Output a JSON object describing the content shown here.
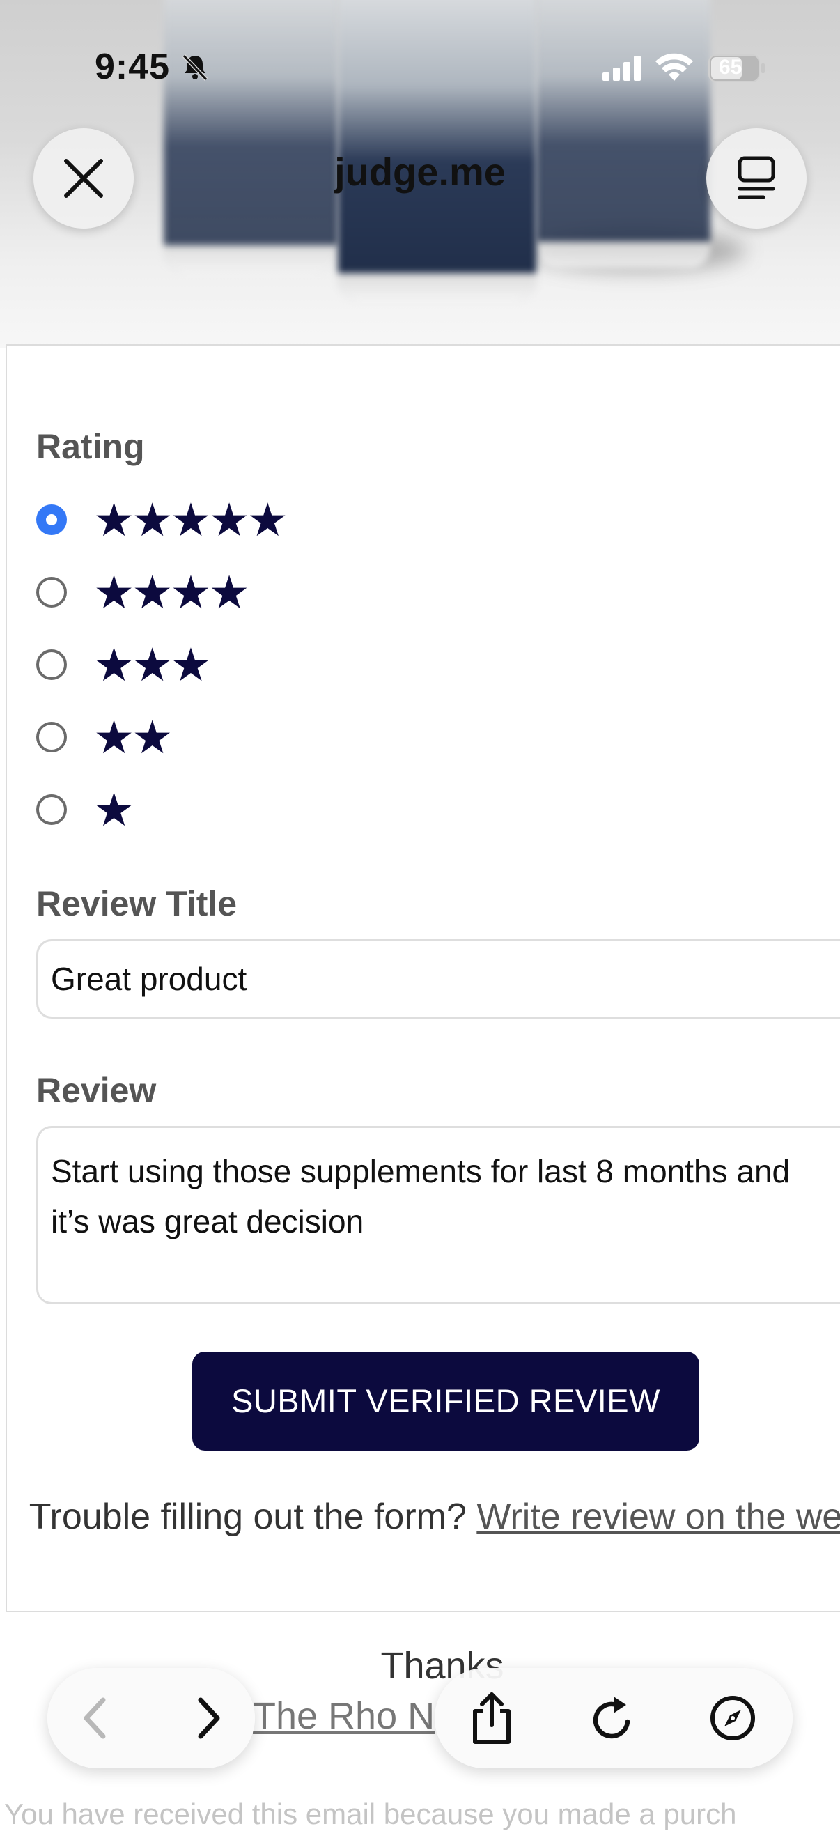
{
  "status_bar": {
    "time": "9:45",
    "battery": "65"
  },
  "header": {
    "site_title": "judge.me"
  },
  "form": {
    "rating_label": "Rating",
    "rating_options": [
      {
        "stars": "★★★★★",
        "value": 5,
        "selected": true
      },
      {
        "stars": "★★★★",
        "value": 4,
        "selected": false
      },
      {
        "stars": "★★★",
        "value": 3,
        "selected": false
      },
      {
        "stars": "★★",
        "value": 2,
        "selected": false
      },
      {
        "stars": "★",
        "value": 1,
        "selected": false
      }
    ],
    "review_title_label": "Review Title",
    "review_title_value": "Great product",
    "review_label": "Review",
    "review_value_line1": "Start using those supplements for last 8 months and",
    "review_value_line2": "it’s was great decision",
    "submit_label": "SUBMIT VERIFIED REVIEW",
    "trouble_text": "Trouble filling out the form?",
    "trouble_link": "Write review on the web"
  },
  "footer": {
    "thanks": "Thanks",
    "shop_name": "The Rho N",
    "note": "You have received this email because you made a purch"
  },
  "toolbar": {
    "back_icon": "chevron-left-icon",
    "forward_icon": "chevron-right-icon",
    "share_icon": "share-icon",
    "reload_icon": "reload-icon",
    "compass_icon": "compass-icon"
  },
  "colors": {
    "star": "#0c0a3e",
    "submit_bg": "#0c0a3e",
    "radio_selected": "#3478f6"
  }
}
